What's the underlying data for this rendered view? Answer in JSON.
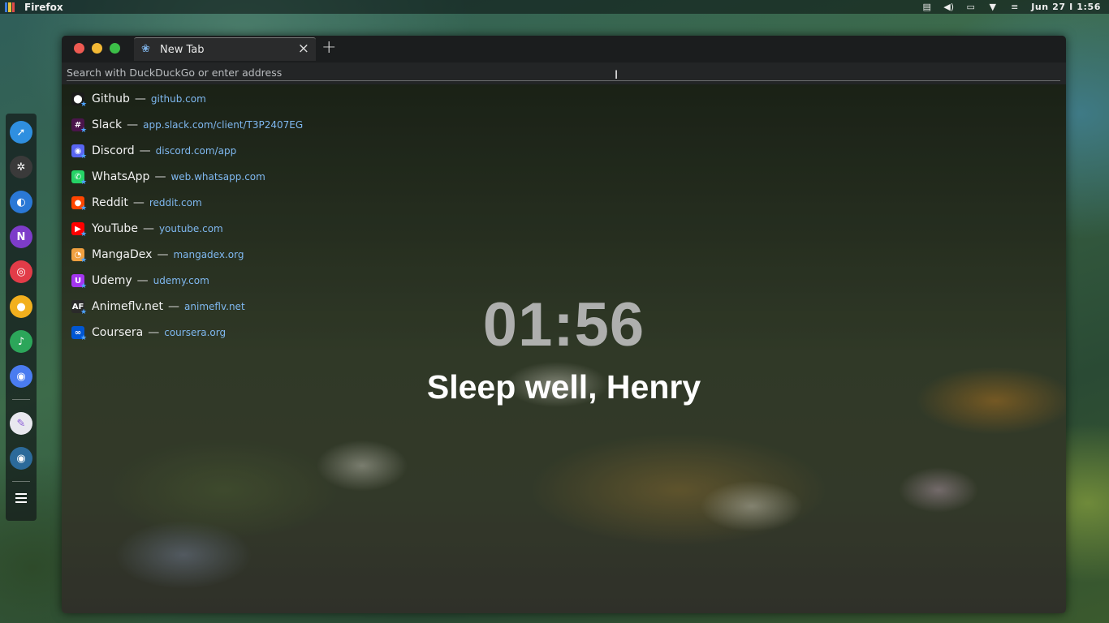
{
  "top_panel": {
    "active_app": "Firefox",
    "clock": "Jun 27 Ⅰ 1:56"
  },
  "dock": {
    "items": [
      "safari-icon",
      "slack-icon",
      "firefox-icon",
      "notion-icon",
      "record-icon",
      "idea-icon",
      "music-icon",
      "discord-icon",
      "editor-icon",
      "disk-icon"
    ]
  },
  "browser": {
    "tab_title": "New Tab",
    "address_placeholder": "Search with DuckDuckGo or enter address",
    "shortcuts": [
      {
        "name": "Github",
        "url": "github.com",
        "icon_bg": "#1b1b1b",
        "icon_glyph": "⬤"
      },
      {
        "name": "Slack",
        "url": "app.slack.com/client/T3P2407EG",
        "icon_bg": "#4a154b",
        "icon_glyph": "#"
      },
      {
        "name": "Discord",
        "url": "discord.com/app",
        "icon_bg": "#5865f2",
        "icon_glyph": "◉"
      },
      {
        "name": "WhatsApp",
        "url": "web.whatsapp.com",
        "icon_bg": "#25d366",
        "icon_glyph": "✆"
      },
      {
        "name": "Reddit",
        "url": "reddit.com",
        "icon_bg": "#ff4500",
        "icon_glyph": "●"
      },
      {
        "name": "YouTube",
        "url": "youtube.com",
        "icon_bg": "#ff0000",
        "icon_glyph": "▶"
      },
      {
        "name": "MangaDex",
        "url": "mangadex.org",
        "icon_bg": "#f0a040",
        "icon_glyph": "◔"
      },
      {
        "name": "Udemy",
        "url": "udemy.com",
        "icon_bg": "#a435f0",
        "icon_glyph": "U"
      },
      {
        "name": "Animeflv.net",
        "url": "animeflv.net",
        "icon_bg": "#2a2a2a",
        "icon_glyph": "AF"
      },
      {
        "name": "Coursera",
        "url": "coursera.org",
        "icon_bg": "#0056d2",
        "icon_glyph": "∞"
      }
    ],
    "separator": "—",
    "time": "01:56",
    "greeting": "Sleep well, Henry"
  }
}
